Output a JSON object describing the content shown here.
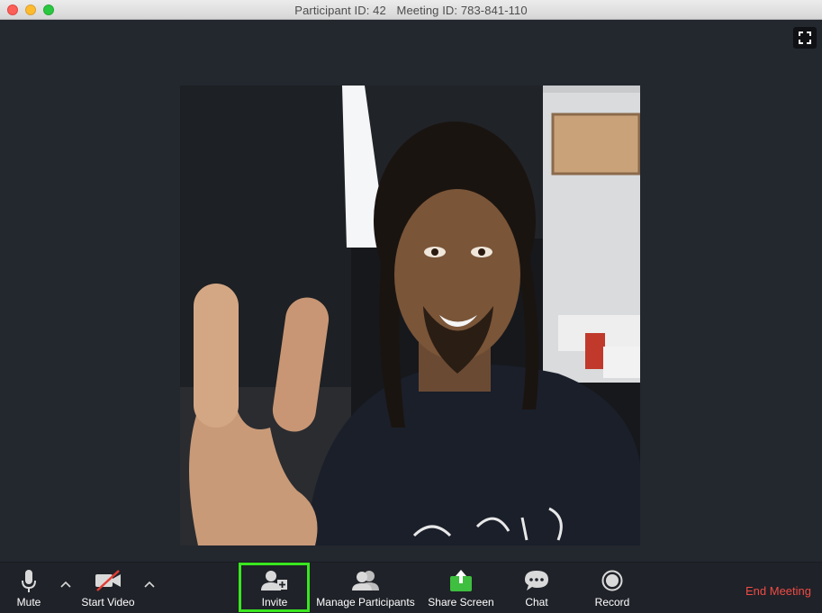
{
  "window": {
    "participant_id_label": "Participant ID: 42",
    "meeting_id_label": "Meeting ID: 783-841-110"
  },
  "video": {
    "participant": "participant video feed"
  },
  "toolbar": {
    "mute_label": "Mute",
    "start_video_label": "Start Video",
    "invite_label": "Invite",
    "manage_participants_label": "Manage Participants",
    "share_screen_label": "Share Screen",
    "chat_label": "Chat",
    "record_label": "Record",
    "end_meeting_label": "End Meeting",
    "caret_glyph": "^"
  },
  "colors": {
    "highlight": "#39e61f",
    "end_meeting": "#ee4b45",
    "share_screen": "#3fbf3f",
    "background": "#23272e"
  }
}
